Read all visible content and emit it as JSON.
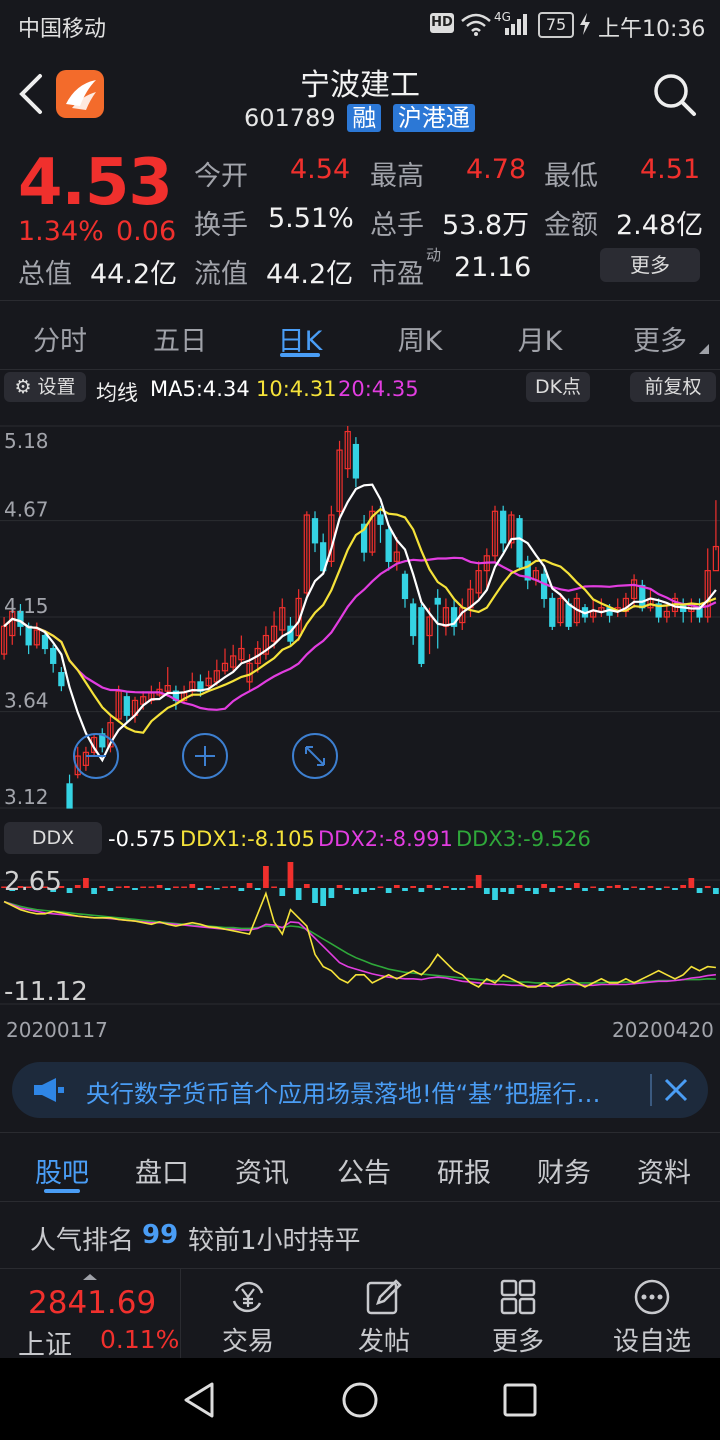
{
  "status_bar": {
    "carrier": "中国移动",
    "network": "4G",
    "battery": "75",
    "time": "上午10:36"
  },
  "header": {
    "stock_name": "宁波建工",
    "stock_code": "601789",
    "tag_margin": "融",
    "tag_connect": "沪港通",
    "back_icon": "chevron-left-icon",
    "search_icon": "search-icon"
  },
  "quote": {
    "price": "4.53",
    "change_pct": "1.34%",
    "change_amt": "0.06",
    "open_label": "今开",
    "open_value": "4.54",
    "high_label": "最高",
    "high_value": "4.78",
    "low_label": "最低",
    "low_value": "4.51",
    "turnover_label": "换手",
    "turnover_value": "5.51%",
    "volume_label": "总手",
    "volume_value": "53.8万",
    "amount_label": "金额",
    "amount_value": "2.48亿",
    "mcap_label": "总值",
    "mcap_value": "44.2亿",
    "float_label": "流值",
    "float_value": "44.2亿",
    "pe_label": "市盈",
    "pe_sup": "动",
    "pe_value": "21.16",
    "more_button": "更多"
  },
  "kline_tabs": [
    "分时",
    "五日",
    "日K",
    "周K",
    "月K",
    "更多"
  ],
  "ma_bar": {
    "settings_label": "设置",
    "ma_title": "均线",
    "ma5": "MA5:4.34",
    "ma10": "10:4.31",
    "ma20": "20:4.35",
    "dk_button": "DK点",
    "adjust_button": "前复权"
  },
  "ddx_bar": {
    "label": "DDX",
    "value": "-0.575",
    "ddx1": "DDX1:-8.105",
    "ddx2": "DDX2:-8.991",
    "ddx3": "DDX3:-9.526"
  },
  "dates": {
    "start": "20200117",
    "end": "20200420"
  },
  "news": {
    "text": "央行数字货币首个应用场景落地!借“基”把握行…"
  },
  "info_tabs": [
    "股吧",
    "盘口",
    "资讯",
    "公告",
    "研报",
    "财务",
    "资料"
  ],
  "rank": {
    "label": "人气排名",
    "value": "99",
    "note": "较前1小时持平"
  },
  "bottom_bar": {
    "index_value": "2841.69",
    "index_name": "上证",
    "index_change": "0.11%",
    "items": [
      "交易",
      "发帖",
      "更多",
      "设自选"
    ]
  },
  "colors": {
    "up": "#f0302d",
    "down": "#35d3e3",
    "ma5": "#ffffff",
    "ma10": "#f5e23a",
    "ma20": "#e23de0",
    "accent": "#4a9df5",
    "ddx1": "#f5e23a",
    "ddx2": "#e23de0",
    "ddx3": "#2fa83a"
  },
  "chart_data": [
    {
      "type": "candlestick",
      "y_ticks": [
        "5.18",
        "4.67",
        "4.15",
        "3.64",
        "3.12"
      ],
      "ylim": [
        3.12,
        5.18
      ],
      "candles": [
        [
          3.95,
          4.1,
          4.15,
          3.92
        ],
        [
          4.05,
          4.18,
          4.22,
          4.0
        ],
        [
          4.18,
          4.1,
          4.22,
          4.05
        ],
        [
          4.1,
          4.0,
          4.12,
          3.95
        ],
        [
          4.0,
          4.08,
          4.12,
          3.98
        ],
        [
          4.05,
          3.98,
          4.08,
          3.95
        ],
        [
          3.98,
          3.9,
          4.0,
          3.85
        ],
        [
          3.85,
          3.78,
          3.88,
          3.75
        ],
        [
          3.25,
          3.12,
          3.3,
          3.12
        ],
        [
          3.3,
          3.4,
          3.45,
          3.28
        ],
        [
          3.35,
          3.42,
          3.45,
          3.32
        ],
        [
          3.42,
          3.5,
          3.52,
          3.4
        ],
        [
          3.52,
          3.45,
          3.55,
          3.42
        ],
        [
          3.45,
          3.58,
          3.62,
          3.42
        ],
        [
          3.6,
          3.75,
          3.78,
          3.58
        ],
        [
          3.72,
          3.62,
          3.75,
          3.58
        ],
        [
          3.62,
          3.7,
          3.72,
          3.58
        ],
        [
          3.68,
          3.72,
          3.75,
          3.65
        ],
        [
          3.7,
          3.74,
          3.78,
          3.68
        ],
        [
          3.73,
          3.76,
          3.8,
          3.72
        ],
        [
          3.75,
          3.78,
          3.88,
          3.72
        ],
        [
          3.75,
          3.7,
          3.78,
          3.65
        ],
        [
          3.7,
          3.74,
          3.78,
          3.68
        ],
        [
          3.75,
          3.8,
          3.85,
          3.72
        ],
        [
          3.8,
          3.75,
          3.84,
          3.72
        ],
        [
          3.78,
          3.82,
          3.86,
          3.75
        ],
        [
          3.8,
          3.86,
          3.92,
          3.78
        ],
        [
          3.86,
          3.9,
          3.98,
          3.84
        ],
        [
          3.88,
          3.94,
          4.0,
          3.85
        ],
        [
          3.92,
          3.98,
          4.05,
          3.9
        ],
        [
          3.8,
          3.9,
          3.95,
          3.75
        ],
        [
          3.9,
          3.98,
          4.02,
          3.85
        ],
        [
          3.95,
          4.05,
          4.1,
          3.92
        ],
        [
          4.02,
          4.1,
          4.18,
          3.98
        ],
        [
          4.08,
          4.2,
          4.25,
          4.05
        ],
        [
          4.1,
          4.02,
          4.15,
          4.0
        ],
        [
          4.05,
          4.25,
          4.3,
          4.02
        ],
        [
          4.28,
          4.7,
          4.72,
          4.25
        ],
        [
          4.68,
          4.55,
          4.72,
          4.5
        ],
        [
          4.55,
          4.4,
          4.6,
          4.38
        ],
        [
          4.45,
          4.7,
          4.75,
          4.42
        ],
        [
          4.72,
          5.05,
          5.1,
          4.68
        ],
        [
          4.95,
          5.15,
          5.18,
          4.9
        ],
        [
          5.08,
          4.9,
          5.12,
          4.85
        ],
        [
          4.65,
          4.5,
          4.7,
          4.45
        ],
        [
          4.5,
          4.72,
          4.75,
          4.48
        ],
        [
          4.7,
          4.65,
          4.75,
          4.55
        ],
        [
          4.62,
          4.45,
          4.65,
          4.4
        ],
        [
          4.45,
          4.5,
          4.58,
          4.4
        ],
        [
          4.38,
          4.25,
          4.4,
          4.2
        ],
        [
          4.22,
          4.05,
          4.25,
          4.0
        ],
        [
          4.2,
          3.9,
          4.22,
          3.88
        ],
        [
          4.05,
          4.15,
          4.2,
          3.95
        ],
        [
          4.25,
          4.22,
          4.3,
          3.98
        ],
        [
          4.1,
          4.2,
          4.25,
          4.05
        ],
        [
          4.2,
          4.1,
          4.25,
          4.05
        ],
        [
          4.12,
          4.2,
          4.25,
          4.08
        ],
        [
          4.2,
          4.3,
          4.35,
          4.15
        ],
        [
          4.28,
          4.4,
          4.45,
          4.25
        ],
        [
          4.4,
          4.48,
          4.52,
          4.3
        ],
        [
          4.48,
          4.72,
          4.75,
          4.45
        ],
        [
          4.72,
          4.55,
          4.75,
          4.5
        ],
        [
          4.55,
          4.7,
          4.72,
          4.52
        ],
        [
          4.68,
          4.42,
          4.7,
          4.4
        ],
        [
          4.45,
          4.35,
          4.48,
          4.3
        ],
        [
          4.35,
          4.4,
          4.42,
          4.32
        ],
        [
          4.38,
          4.25,
          4.42,
          4.2
        ],
        [
          4.25,
          4.1,
          4.28,
          4.08
        ],
        [
          4.12,
          4.25,
          4.28,
          4.1
        ],
        [
          4.22,
          4.1,
          4.25,
          4.08
        ],
        [
          4.12,
          4.25,
          4.28,
          4.1
        ],
        [
          4.2,
          4.15,
          4.22,
          4.12
        ],
        [
          4.15,
          4.18,
          4.25,
          4.12
        ],
        [
          4.18,
          4.2,
          4.25,
          4.15
        ],
        [
          4.2,
          4.16,
          4.22,
          4.12
        ],
        [
          4.18,
          4.2,
          4.25,
          4.15
        ],
        [
          4.18,
          4.25,
          4.28,
          4.15
        ],
        [
          4.25,
          4.35,
          4.38,
          4.2
        ],
        [
          4.32,
          4.2,
          4.35,
          4.18
        ],
        [
          4.2,
          4.25,
          4.3,
          4.18
        ],
        [
          4.22,
          4.15,
          4.25,
          4.12
        ],
        [
          4.15,
          4.18,
          4.22,
          4.12
        ],
        [
          4.18,
          4.25,
          4.28,
          4.15
        ],
        [
          4.22,
          4.18,
          4.25,
          4.12
        ],
        [
          4.18,
          4.22,
          4.25,
          4.12
        ],
        [
          4.2,
          4.15,
          4.25,
          4.12
        ],
        [
          4.15,
          4.4,
          4.52,
          4.12
        ],
        [
          4.4,
          4.53,
          4.78,
          4.51
        ]
      ],
      "ma5_label": "MA5",
      "ma10_label": "10",
      "ma20_label": "20"
    },
    {
      "type": "bar+line",
      "y_ticks": [
        "2.65",
        "-11.12"
      ],
      "ylim": [
        -11.12,
        2.65
      ],
      "ddx_bars": [
        0.1,
        -0.3,
        0.2,
        0.1,
        -0.2,
        0.1,
        -0.4,
        0.2,
        -0.5,
        0.3,
        1.0,
        -0.6,
        0.2,
        -0.3,
        0.1,
        0.2,
        -0.2,
        0.1,
        0.0,
        0.3,
        -0.2,
        0.1,
        0.1,
        0.4,
        -0.2,
        0.2,
        -0.1,
        0.1,
        0.2,
        -0.3,
        0.5,
        -0.2,
        2.2,
        0.1,
        -0.8,
        2.6,
        -1.2,
        0.4,
        -1.5,
        -1.8,
        -1.0,
        0.3,
        -0.2,
        -0.6,
        -0.4,
        -0.2,
        0.1,
        -0.5,
        0.3,
        -0.3,
        0.2,
        -0.4,
        0.3,
        -0.2,
        0.2,
        -0.2,
        -0.2,
        0.2,
        1.3,
        -0.6,
        -1.2,
        -0.4,
        -0.6,
        0.3,
        -0.3,
        -0.6,
        0.4,
        -0.4,
        0.2,
        -0.2,
        0.5,
        -0.3,
        0.1,
        -0.3,
        0.2,
        0.3,
        -0.2,
        0.1,
        -0.2,
        0.2,
        -0.2,
        0.1,
        -0.2,
        0.3,
        1.0,
        -0.5,
        0.2,
        -0.6
      ],
      "ddx1_line": [
        0.0,
        -0.5,
        -1.0,
        -1.3,
        -1.5,
        -1.5,
        -1.2,
        -1.4,
        -1.6,
        -1.8,
        -1.9,
        -2.0,
        -2.0,
        -2.0,
        -2.2,
        -2.3,
        -2.4,
        -2.6,
        -2.8,
        -2.5,
        -2.8,
        -3.0,
        -2.8,
        -2.6,
        -2.8,
        -3.1,
        -3.2,
        -3.4,
        -3.6,
        -3.8,
        -4.0,
        -1.5,
        1.0,
        -2.5,
        -4.0,
        -1.0,
        -2.0,
        -3.0,
        -6.5,
        -8.0,
        -8.5,
        -9.5,
        -10.0,
        -9.0,
        -9.0,
        -10.0,
        -9.5,
        -9.0,
        -9.5,
        -9.0,
        -8.5,
        -9.0,
        -8.0,
        -6.5,
        -7.5,
        -8.5,
        -9.0,
        -10.0,
        -10.5,
        -9.5,
        -10.0,
        -9.0,
        -9.5,
        -10.0,
        -10.5,
        -10.5,
        -10.0,
        -10.5,
        -10.0,
        -9.5,
        -10.0,
        -10.5,
        -10.0,
        -9.5,
        -10.0,
        -10.0,
        -9.5,
        -10.0,
        -9.5,
        -9.0,
        -8.5,
        -9.0,
        -9.5,
        -9.0,
        -8.0,
        -8.5,
        -8.0,
        -8.105
      ],
      "ddx2_line": [
        0.0,
        -0.4,
        -0.8,
        -1.0,
        -1.2,
        -1.4,
        -1.5,
        -1.6,
        -1.7,
        -1.8,
        -1.9,
        -2.0,
        -2.0,
        -2.1,
        -2.2,
        -2.3,
        -2.4,
        -2.5,
        -2.6,
        -2.6,
        -2.7,
        -2.8,
        -2.9,
        -3.0,
        -3.1,
        -3.2,
        -3.3,
        -3.4,
        -3.4,
        -3.5,
        -3.5,
        -3.3,
        -2.8,
        -2.9,
        -3.2,
        -2.5,
        -2.6,
        -3.5,
        -4.5,
        -5.5,
        -6.5,
        -7.5,
        -8.0,
        -8.3,
        -8.6,
        -8.9,
        -9.1,
        -9.3,
        -9.4,
        -9.5,
        -9.5,
        -9.6,
        -9.4,
        -9.3,
        -9.4,
        -9.6,
        -9.8,
        -9.9,
        -10.0,
        -10.1,
        -10.2,
        -10.2,
        -10.3,
        -10.3,
        -10.4,
        -10.4,
        -10.4,
        -10.4,
        -10.3,
        -10.2,
        -10.2,
        -10.3,
        -10.3,
        -10.2,
        -10.2,
        -10.2,
        -10.2,
        -10.1,
        -10.0,
        -9.9,
        -9.8,
        -9.8,
        -9.7,
        -9.6,
        -9.4,
        -9.3,
        -9.1,
        -8.991
      ],
      "ddx3_line": [
        0.0,
        -0.3,
        -0.6,
        -0.8,
        -1.0,
        -1.1,
        -1.2,
        -1.3,
        -1.4,
        -1.5,
        -1.6,
        -1.7,
        -1.8,
        -1.9,
        -2.0,
        -2.1,
        -2.2,
        -2.3,
        -2.4,
        -2.5,
        -2.6,
        -2.7,
        -2.8,
        -2.9,
        -3.0,
        -3.0,
        -3.1,
        -3.2,
        -3.2,
        -3.3,
        -3.3,
        -3.2,
        -3.0,
        -3.1,
        -3.2,
        -3.0,
        -3.1,
        -3.4,
        -4.0,
        -4.6,
        -5.2,
        -5.8,
        -6.4,
        -6.9,
        -7.3,
        -7.7,
        -8.0,
        -8.3,
        -8.5,
        -8.7,
        -8.8,
        -8.9,
        -9.0,
        -9.1,
        -9.2,
        -9.3,
        -9.4,
        -9.5,
        -9.6,
        -9.7,
        -9.7,
        -9.8,
        -9.8,
        -9.9,
        -9.9,
        -10.0,
        -10.0,
        -10.0,
        -10.0,
        -10.0,
        -10.0,
        -10.0,
        -10.0,
        -10.0,
        -9.9,
        -9.9,
        -9.9,
        -9.9,
        -9.8,
        -9.8,
        -9.7,
        -9.7,
        -9.7,
        -9.6,
        -9.6,
        -9.6,
        -9.5,
        -9.526
      ]
    }
  ]
}
